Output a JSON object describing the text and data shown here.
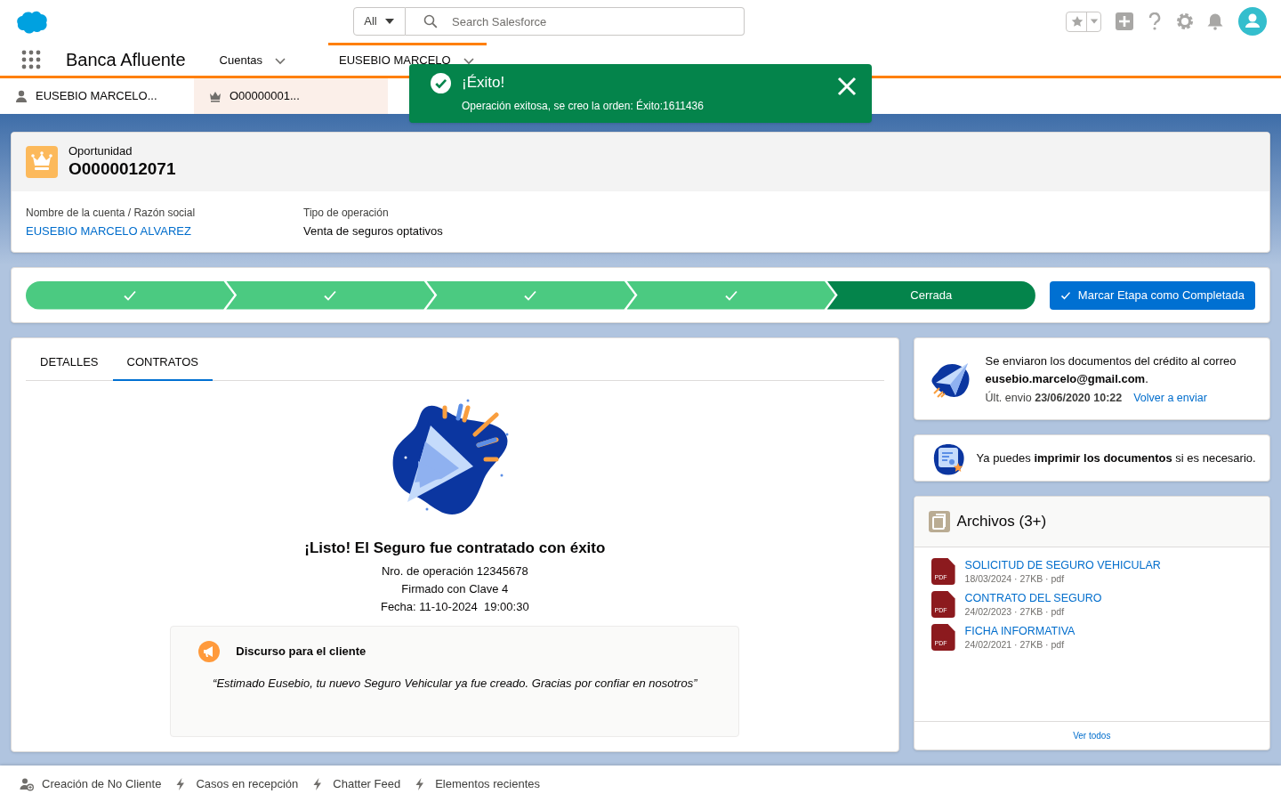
{
  "global_header": {
    "search": {
      "scope": "All",
      "placeholder": "Search Salesforce"
    }
  },
  "nav": {
    "app_name": "Banca Afluente",
    "tabs": [
      {
        "label": "Cuentas",
        "selected": false
      },
      {
        "label": "EUSEBIO MARCELO",
        "selected": true
      }
    ]
  },
  "subtabs": [
    {
      "label": "EUSEBIO MARCELO...",
      "kind": "person",
      "selected": false
    },
    {
      "label": "O00000001...",
      "kind": "crown",
      "selected": true
    }
  ],
  "toast": {
    "title": "¡Éxito!",
    "message": "Operación exitosa, se creo la orden: Éxito:1611436"
  },
  "record": {
    "object": "Oportunidad",
    "name": "O0000012071",
    "fields": [
      {
        "label": "Nombre de la cuenta / Razón social",
        "value": "EUSEBIO MARCELO ALVAREZ",
        "kind": "link"
      },
      {
        "label": "Tipo de operación",
        "value": "Venta de seguros optativos",
        "kind": "text"
      }
    ]
  },
  "path": {
    "stages": [
      {
        "completed": true,
        "selected": false
      },
      {
        "completed": true,
        "selected": false
      },
      {
        "completed": true,
        "selected": false
      },
      {
        "completed": true,
        "selected": false
      },
      {
        "label": "Cerrada",
        "completed": false,
        "selected": true
      }
    ],
    "button": "Marcar Etapa como Completada"
  },
  "contract_card": {
    "tabs": [
      {
        "label": "DETALLES",
        "selected": false
      },
      {
        "label": "CONTRATOS",
        "selected": true
      }
    ],
    "title": "¡Listo! El Seguro fue contratado con éxito",
    "lines": [
      "Nro. de operación 12345678",
      "Firmado con Clave 4",
      "Fecha: 11-10-2024  19:00:30"
    ],
    "speech": {
      "title": "Discurso para el cliente",
      "text": "“Estimado Eusebio, tu nuevo Seguro Vehicular ya fue creado. Gracias por confiar en nosotros”"
    }
  },
  "email_card": {
    "text": "Se enviaron los documentos del crédito al correo **eusebio.marcelo@gmail.com**.",
    "last_sent": "Últ. envio **23/06/2020 10:22**",
    "link": "Volver a enviar"
  },
  "print_card": {
    "text": "Ya puedes **imprimir los documentos** si es necesario."
  },
  "files": {
    "title": "Archivos (3+)",
    "items": [
      {
        "name": "SOLICITUD DE SEGURO VEHICULAR",
        "meta": "18/03/2024 · 27KB · pdf",
        "type_label": "PDF"
      },
      {
        "name": "CONTRATO DEL SEGURO",
        "meta": "24/02/2023 · 27KB · pdf",
        "type_label": "PDF"
      },
      {
        "name": "FICHA INFORMATIVA",
        "meta": "24/02/2021 · 27KB · pdf",
        "type_label": "PDF"
      }
    ],
    "footer_link": "Ver todos"
  },
  "utility_bar": [
    {
      "label": "Creación de No Cliente",
      "kind": "contact"
    },
    {
      "label": "Casos en recepción",
      "kind": "action"
    },
    {
      "label": "Chatter Feed",
      "kind": "action"
    },
    {
      "label": "Elementos recientes",
      "kind": "action"
    }
  ]
}
